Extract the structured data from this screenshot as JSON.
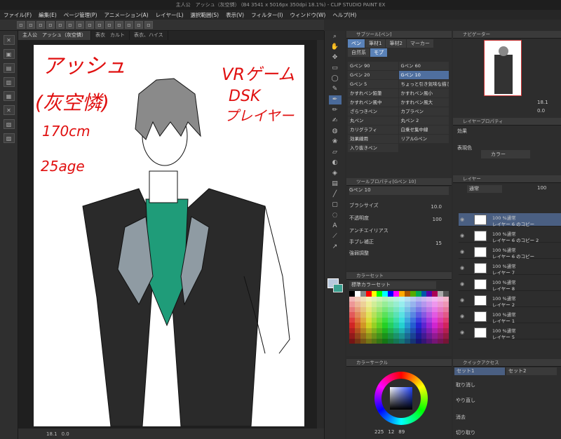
{
  "app": {
    "title": "主人公　アッシュ（灰空憐） (B4 3541 x 5016px 350dpi 18.1%) - CLIP STUDIO PAINT EX"
  },
  "menu": [
    "ファイル(F)",
    "編集(E)",
    "ページ管理(P)",
    "アニメーション(A)",
    "レイヤー(L)",
    "選択範囲(S)",
    "表示(V)",
    "フィルター(I)",
    "ウィンドウ(W)",
    "ヘルプ(H)"
  ],
  "tabs": [
    "主人公　アッシュ（灰空憐）",
    "表衣　カルト",
    "表衣、ハイス"
  ],
  "canvas": {
    "notes_left": [
      "アッシュ",
      "(灰空憐)",
      "170cm",
      "25age"
    ],
    "notes_right": [
      "VRゲーム",
      "DSK",
      "プレイヤー"
    ]
  },
  "status": {
    "zoom": "18.1",
    "angle": "0.0"
  },
  "subtool": {
    "title": "サブツール[ペン]",
    "tabs": [
      "ペン",
      "筆材1",
      "筆材2",
      "マーカー",
      "自然系",
      "モプ"
    ],
    "brushes": [
      "Gペン 90",
      "Gペン 60",
      "Gペン 20",
      "Gペン 10",
      "Gペン 5",
      "ちょっと引き気味な描き文字",
      "かすれペン鉛筆",
      "かすれペン風小",
      "かすれペン風中",
      "かすれペン風大",
      "ざらつきペン",
      "カプラペン",
      "丸ペン",
      "丸ペン 2",
      "カリグラフィ",
      "白乗せ集中線",
      "効果線用",
      "リアルGペン",
      "入り抜きペン"
    ]
  },
  "toolprop": {
    "title": "ツールプロパティ[Gペン 10]",
    "brush_name": "Gペン 10",
    "labels": [
      "ブラシサイズ",
      "不透明度",
      "アンチエイリアス",
      "手ブレ補正",
      "強弱調整"
    ],
    "values": [
      "10.0",
      "100",
      "15"
    ]
  },
  "colorset": {
    "title": "カラーセット",
    "set_name": "標準カラーセット"
  },
  "colorcircle": {
    "title": "カラーサークル",
    "h": "225",
    "s": "12",
    "v": "89"
  },
  "navigator": {
    "title": "ナビゲーター",
    "zoom": "18.1",
    "angle": "0.0"
  },
  "layerprop": {
    "title": "レイヤープロパティ",
    "effect_label": "効果",
    "expr_label": "表現色",
    "color_value": "カラー"
  },
  "layers": {
    "title": "レイヤー",
    "blend": "通常",
    "opacity": "100",
    "rows": [
      {
        "mode": "100 %通常",
        "name": "レイヤー 6 のコピー"
      },
      {
        "mode": "100 %通常",
        "name": "レイヤー 6 のコピー 2"
      },
      {
        "mode": "100 %通常",
        "name": "レイヤー 6 のコピー"
      },
      {
        "mode": "100 %通常",
        "name": "レイヤー 7"
      },
      {
        "mode": "100 %通常",
        "name": "レイヤー 8"
      },
      {
        "mode": "100 %通常",
        "name": "レイヤー 2"
      },
      {
        "mode": "100 %通常",
        "name": "レイヤー 1"
      },
      {
        "mode": "100 %通常",
        "name": "レイヤー 5"
      }
    ]
  },
  "quick": {
    "title": "クイックアクセス",
    "set1": "セット1",
    "set2": "セット2",
    "items": [
      "取り消し",
      "やり直し",
      "消去",
      "切り取り"
    ]
  },
  "colors": {
    "main": "#b8c8dc",
    "sub": "#3aa090"
  }
}
